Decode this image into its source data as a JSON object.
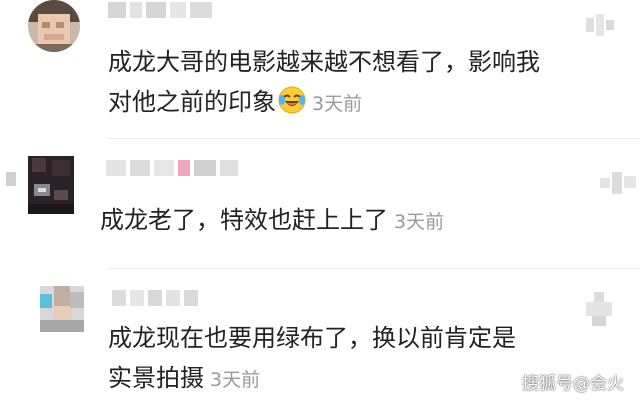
{
  "comments": [
    {
      "text": "成龙大哥的电影越来越不想看了，影响我对他之前的印象",
      "emoji": "laughing-crying-emoji",
      "time": "3天前"
    },
    {
      "text": "成龙老了，特效也赶上上了",
      "time": "3天前"
    },
    {
      "text": "成龙现在也要用绿布了，换以前肯定是实景拍摄",
      "time": "3天前"
    }
  ],
  "watermark": "搜狐号@会火",
  "colors": {
    "text": "#222222",
    "time": "#9a9a9a",
    "blur": "#d6d6d6"
  }
}
